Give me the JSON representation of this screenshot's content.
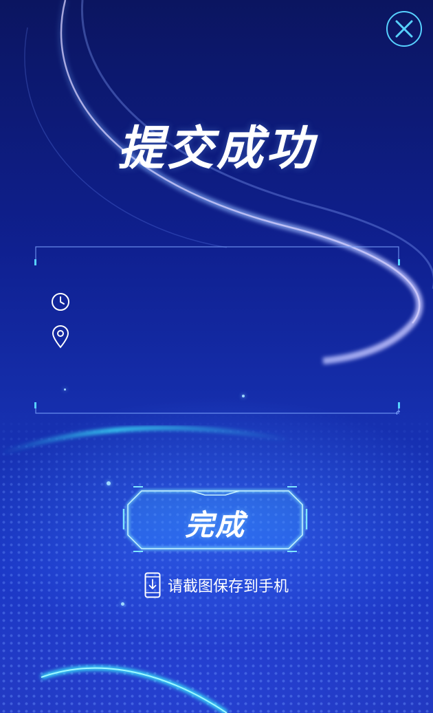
{
  "page": {
    "title": "提交成功",
    "close_icon": "close-icon"
  },
  "info": {
    "time_icon": "clock-icon",
    "time_value": "",
    "location_icon": "location-pin-icon",
    "location_value": ""
  },
  "actions": {
    "done_label": "完成"
  },
  "footer": {
    "phone_icon": "phone-download-icon",
    "save_hint": "请截图保存到手机"
  },
  "colors": {
    "accent": "#57d1ff",
    "background_top": "#0b1560",
    "background_bottom": "#1a36c4",
    "text": "#ffffff"
  }
}
